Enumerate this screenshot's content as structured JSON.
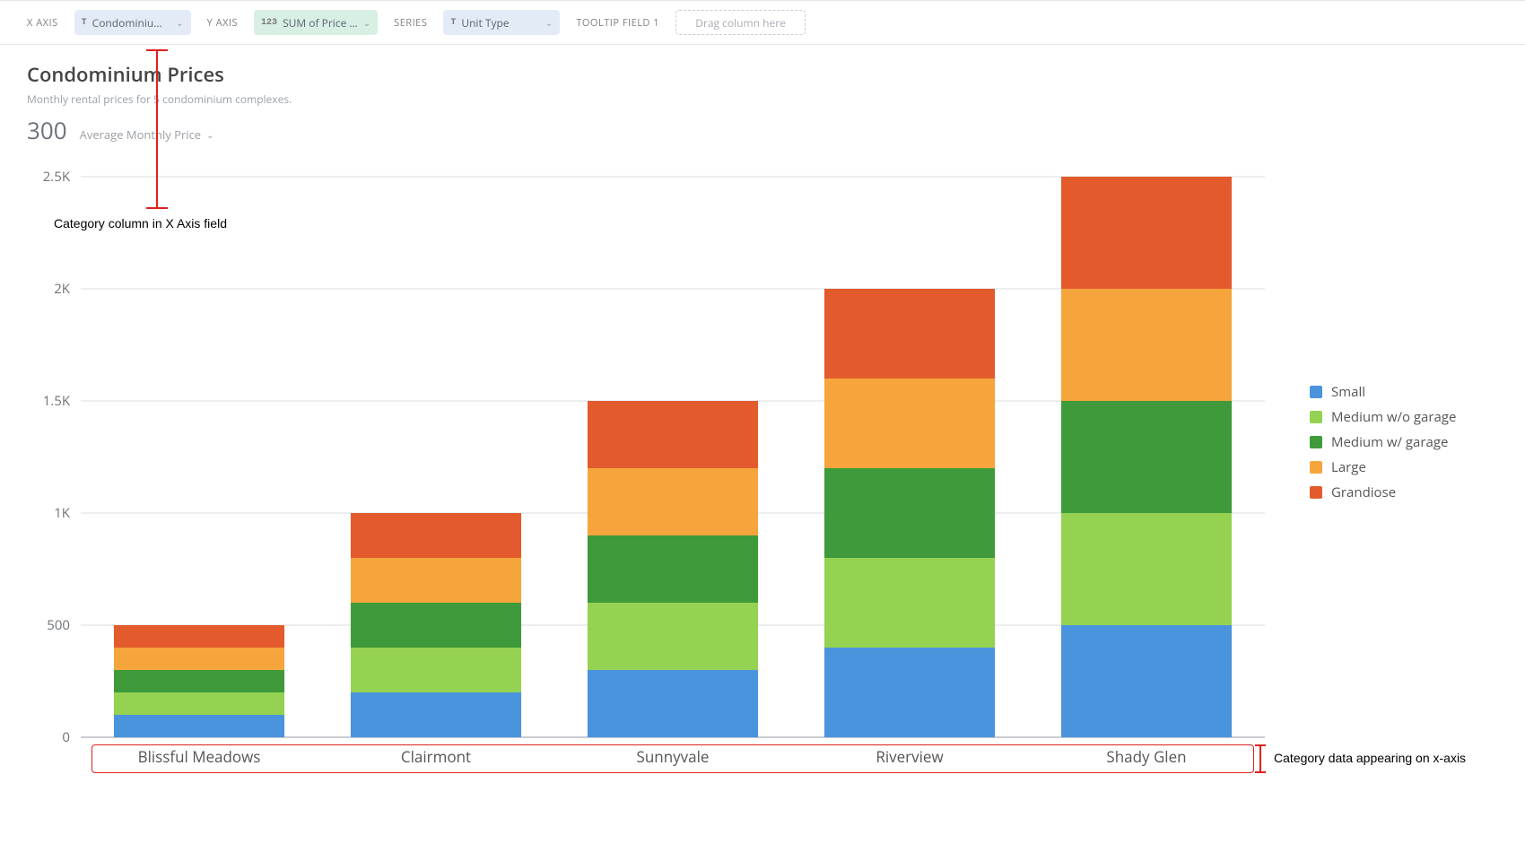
{
  "toolbar": {
    "xaxis_label": "X AXIS",
    "xaxis_chip": "Condominiu…",
    "yaxis_label": "Y AXIS",
    "yaxis_chip": "SUM of Price …",
    "series_label": "SERIES",
    "series_chip": "Unit Type",
    "tooltip_label": "TOOLTIP FIELD 1",
    "drop_placeholder": "Drag column here"
  },
  "header": {
    "title": "Condominium Prices",
    "subtitle": "Monthly rental prices for 5 condominium complexes.",
    "metric_value": "300",
    "metric_label": "Average Monthly Price"
  },
  "legend": {
    "items": [
      {
        "name": "Small",
        "color": "#4a94dd"
      },
      {
        "name": "Medium w/o garage",
        "color": "#95d252"
      },
      {
        "name": "Medium w/ garage",
        "color": "#3e9a3a"
      },
      {
        "name": "Large",
        "color": "#f6a53c"
      },
      {
        "name": "Grandiose",
        "color": "#e35b2c"
      }
    ]
  },
  "annotations": {
    "top": "Category column in X Axis field",
    "bottom": "Category data appearing on x-axis"
  },
  "chart_data": {
    "type": "bar",
    "stacked": true,
    "title": "Condominium Prices",
    "xlabel": "",
    "ylabel": "",
    "ylim": [
      0,
      2500
    ],
    "y_ticks": [
      0,
      500,
      1000,
      1500,
      2000,
      2500
    ],
    "categories": [
      "Blissful Meadows",
      "Clairmont",
      "Sunnyvale",
      "Riverview",
      "Shady Glen"
    ],
    "series": [
      {
        "name": "Small",
        "color": "#4a94dd",
        "values": [
          100,
          200,
          300,
          400,
          500
        ]
      },
      {
        "name": "Medium w/o garage",
        "color": "#95d252",
        "values": [
          100,
          200,
          300,
          400,
          500
        ]
      },
      {
        "name": "Medium w/ garage",
        "color": "#3e9a3a",
        "values": [
          100,
          200,
          300,
          400,
          500
        ]
      },
      {
        "name": "Large",
        "color": "#f6a53c",
        "values": [
          100,
          200,
          300,
          400,
          500
        ]
      },
      {
        "name": "Grandiose",
        "color": "#e35b2c",
        "values": [
          100,
          200,
          300,
          400,
          500
        ]
      }
    ]
  }
}
